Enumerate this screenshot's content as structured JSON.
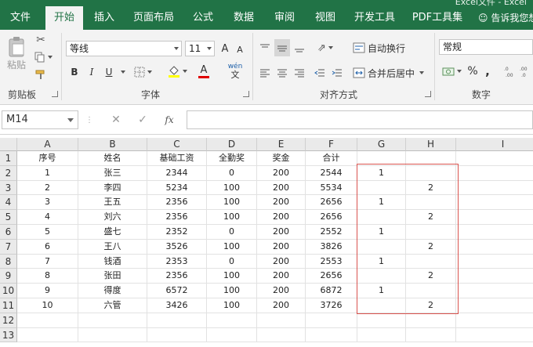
{
  "window": {
    "title": "Excel文件 - Excel"
  },
  "tabs": [
    {
      "label": "文件",
      "active": false
    },
    {
      "label": "开始",
      "active": true
    },
    {
      "label": "插入",
      "active": false
    },
    {
      "label": "页面布局",
      "active": false
    },
    {
      "label": "公式",
      "active": false
    },
    {
      "label": "数据",
      "active": false
    },
    {
      "label": "审阅",
      "active": false
    },
    {
      "label": "视图",
      "active": false
    },
    {
      "label": "开发工具",
      "active": false
    },
    {
      "label": "PDF工具集",
      "active": false
    }
  ],
  "tell_me": "告诉我您想",
  "ribbon": {
    "clipboard": {
      "label": "剪贴板",
      "paste": "粘贴"
    },
    "font": {
      "label": "字体",
      "name": "等线",
      "size": "11",
      "bold": "B",
      "italic": "I",
      "underline": "U",
      "grow": "A",
      "shrink": "A",
      "color_letter": "A",
      "pinyin": "wén"
    },
    "alignment": {
      "label": "对齐方式",
      "wrap": "自动换行",
      "merge": "合并后居中"
    },
    "number": {
      "label": "数字",
      "format": "常规",
      "percent": "%",
      "comma": ","
    }
  },
  "formula_bar": {
    "name_box": "M14",
    "fx": "fx",
    "value": ""
  },
  "colors": {
    "brand_green": "#217346",
    "selection_red": "#d9534f"
  },
  "sheet": {
    "columns": [
      "A",
      "B",
      "C",
      "D",
      "E",
      "F",
      "G",
      "H",
      "I"
    ],
    "rows": [
      {
        "n": "1",
        "cells": [
          "序号",
          "姓名",
          "基础工资",
          "全勤奖",
          "奖金",
          "合计",
          "",
          "",
          ""
        ]
      },
      {
        "n": "2",
        "cells": [
          "1",
          "张三",
          "2344",
          "0",
          "200",
          "2544",
          "1",
          "",
          ""
        ]
      },
      {
        "n": "3",
        "cells": [
          "2",
          "李四",
          "5234",
          "100",
          "200",
          "5534",
          "",
          "2",
          ""
        ]
      },
      {
        "n": "4",
        "cells": [
          "3",
          "王五",
          "2356",
          "100",
          "200",
          "2656",
          "1",
          "",
          ""
        ]
      },
      {
        "n": "5",
        "cells": [
          "4",
          "刘六",
          "2356",
          "100",
          "200",
          "2656",
          "",
          "2",
          ""
        ]
      },
      {
        "n": "6",
        "cells": [
          "5",
          "盛七",
          "2352",
          "0",
          "200",
          "2552",
          "1",
          "",
          ""
        ]
      },
      {
        "n": "7",
        "cells": [
          "6",
          "王八",
          "3526",
          "100",
          "200",
          "3826",
          "",
          "2",
          ""
        ]
      },
      {
        "n": "8",
        "cells": [
          "7",
          "钱酒",
          "2353",
          "0",
          "200",
          "2553",
          "1",
          "",
          ""
        ]
      },
      {
        "n": "9",
        "cells": [
          "8",
          "张田",
          "2356",
          "100",
          "200",
          "2656",
          "",
          "2",
          ""
        ]
      },
      {
        "n": "10",
        "cells": [
          "9",
          "得度",
          "6572",
          "100",
          "200",
          "6872",
          "1",
          "",
          ""
        ]
      },
      {
        "n": "11",
        "cells": [
          "10",
          "六管",
          "3426",
          "100",
          "200",
          "3726",
          "",
          "2",
          ""
        ]
      },
      {
        "n": "12",
        "cells": [
          "",
          "",
          "",
          "",
          "",
          "",
          "",
          "",
          ""
        ]
      },
      {
        "n": "13",
        "cells": [
          "",
          "",
          "",
          "",
          "",
          "",
          "",
          "",
          ""
        ]
      }
    ]
  }
}
